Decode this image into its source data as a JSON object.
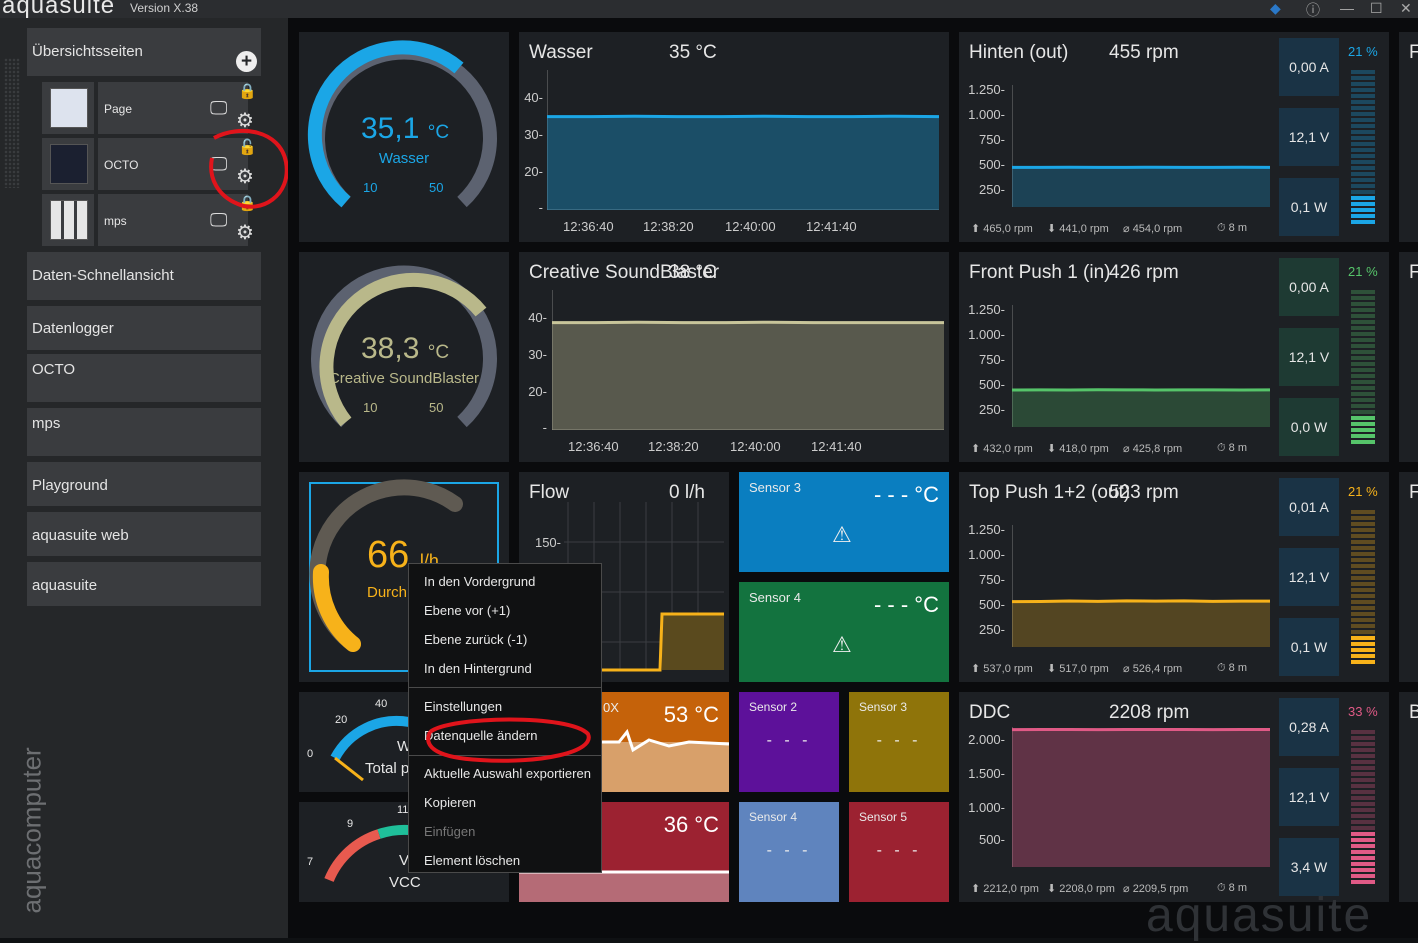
{
  "app": {
    "brand": "aquasuite",
    "version": "Version X.38",
    "sidebar_logo": "aquacomputer",
    "watermark": "aquasuite"
  },
  "sidebar": {
    "overview_label": "Übersichtsseiten",
    "pages": [
      {
        "label": "Page"
      },
      {
        "label": "OCTO"
      },
      {
        "label": "mps"
      }
    ],
    "items": [
      "Daten-Schnellansicht",
      "Datenlogger",
      "OCTO",
      "mps",
      "Playground",
      "aquasuite web",
      "aquasuite"
    ]
  },
  "gauges": [
    {
      "value": "35,1",
      "unit": "°C",
      "name": "Wasser",
      "min": "10",
      "max": "50",
      "color": "#1ba6e6",
      "fraction": 0.64
    },
    {
      "value": "38,3",
      "unit": "°C",
      "name": "Creative SoundBlaster",
      "min": "10",
      "max": "50",
      "color": "#b9b88a",
      "fraction": 0.72
    },
    {
      "value": "66",
      "unit": "l/h",
      "name": "Durch",
      "color": "#f7b21a"
    }
  ],
  "temp_charts": [
    {
      "title": "Wasser",
      "value": "35 °C",
      "yticks": [
        "40-",
        "30-",
        "20-",
        "-"
      ],
      "xticks": [
        "12:36:40",
        "12:38:20",
        "12:40:00",
        "12:41:40"
      ],
      "color": "#1ba6e6",
      "data": [
        35,
        35,
        35.1,
        35,
        35,
        35.1,
        35,
        35,
        35.1,
        35
      ]
    },
    {
      "title": "Creative SoundBlaster",
      "value": "38 °C",
      "yticks": [
        "40-",
        "30-",
        "20-",
        "-"
      ],
      "xticks": [
        "12:36:40",
        "12:38:20",
        "12:40:00",
        "12:41:40"
      ],
      "color": "#c8c59a",
      "data": [
        38,
        38,
        38.1,
        38,
        38,
        38.1,
        38,
        38,
        38,
        38
      ]
    }
  ],
  "flow": {
    "title": "Flow",
    "value": "0 l/h",
    "ytick": "150-"
  },
  "sensor_tiles_large": [
    {
      "label": "Sensor 3",
      "value": "- - - °C",
      "color": "#0a7ec0"
    },
    {
      "label": "Sensor 4",
      "value": "- - - °C",
      "color": "#13733f"
    }
  ],
  "temp_tiles": [
    {
      "label": "0X",
      "value": "53 °C",
      "color": "#c5620a"
    },
    {
      "label": "",
      "value": "36 °C",
      "color": "#9c2231"
    }
  ],
  "sensor_tiles_small": [
    {
      "label": "Sensor 2",
      "value": "- - -",
      "color": "#5d119a"
    },
    {
      "label": "Sensor 3",
      "value": "- - -",
      "color": "#8f740a"
    },
    {
      "label": "Sensor 4",
      "value": "- - -",
      "color": "#5f84be"
    },
    {
      "label": "Sensor 5",
      "value": "- - -",
      "color": "#9c2231"
    }
  ],
  "meters": [
    {
      "text": "Total p",
      "ticks": [
        "0",
        "20",
        "40"
      ],
      "tail": "W"
    },
    {
      "text": "VCC",
      "ticks": [
        "7",
        "9",
        "11"
      ],
      "tail": "V"
    }
  ],
  "fans": [
    {
      "title": "Hinten (out)",
      "value": "455 rpm",
      "yticks": [
        "1.250-",
        "1.000-",
        "750-",
        "500-",
        "250-"
      ],
      "stats": [
        "465,0 rpm",
        "441,0 rpm",
        "454,0 rpm",
        "8 m"
      ],
      "amps": "0,00 A",
      "volts": "12,1 V",
      "watts": "0,1 W",
      "pct": "21 %",
      "pct_value": 21,
      "color": "#1ba6e6",
      "accent_bg": "#1a3345",
      "data": [
        455,
        455,
        456,
        454,
        455,
        456,
        455,
        455,
        456,
        455
      ]
    },
    {
      "title": "Front Push 1 (in)",
      "value": "426 rpm",
      "yticks": [
        "1.250-",
        "1.000-",
        "750-",
        "500-",
        "250-"
      ],
      "stats": [
        "432,0 rpm",
        "418,0 rpm",
        "425,8 rpm",
        "8 m"
      ],
      "amps": "0,00 A",
      "volts": "12,1 V",
      "watts": "0,0 W",
      "pct": "21 %",
      "pct_value": 21,
      "color": "#56c46a",
      "accent_bg": "#1e3a33",
      "data": [
        425,
        426,
        425,
        427,
        426,
        425,
        426,
        426,
        425,
        426
      ]
    },
    {
      "title": "Top Push 1+2 (out)",
      "value": "523 rpm",
      "yticks": [
        "1.250-",
        "1.000-",
        "750-",
        "500-",
        "250-"
      ],
      "stats": [
        "537,0 rpm",
        "517,0 rpm",
        "526,4 rpm",
        "8 m"
      ],
      "amps": "0,01 A",
      "volts": "12,1 V",
      "watts": "0,1 W",
      "pct": "21 %",
      "pct_value": 21,
      "color": "#f7b21a",
      "accent_bg": "#1a3345",
      "data": [
        520,
        522,
        528,
        524,
        530,
        526,
        529,
        524,
        527,
        526
      ]
    },
    {
      "title": "DDC",
      "value": "2208 rpm",
      "yticks": [
        "2.000-",
        "1.500-",
        "1.000-",
        "500-"
      ],
      "stats": [
        "2212,0 rpm",
        "2208,0 rpm",
        "2209,5 rpm",
        "8 m"
      ],
      "amps": "0,28 A",
      "volts": "12,1 V",
      "watts": "3,4 W",
      "pct": "33 %",
      "pct_value": 33,
      "color": "#e05a86",
      "accent_bg": "#1a3345",
      "data": [
        2208,
        2209,
        2210,
        2208,
        2209,
        2210,
        2209,
        2208,
        2209,
        2210
      ]
    }
  ],
  "context_menu": {
    "items": [
      "In den Vordergrund",
      "Ebene vor (+1)",
      "Ebene zurück (-1)",
      "In den Hintergrund",
      "Einstellungen",
      "Datenquelle ändern",
      "Aktuelle Auswahl exportieren",
      "Kopieren",
      "Einfügen",
      "Element löschen"
    ]
  },
  "colors": {
    "highlight": "#e0141b",
    "panel": "#1d2024"
  }
}
